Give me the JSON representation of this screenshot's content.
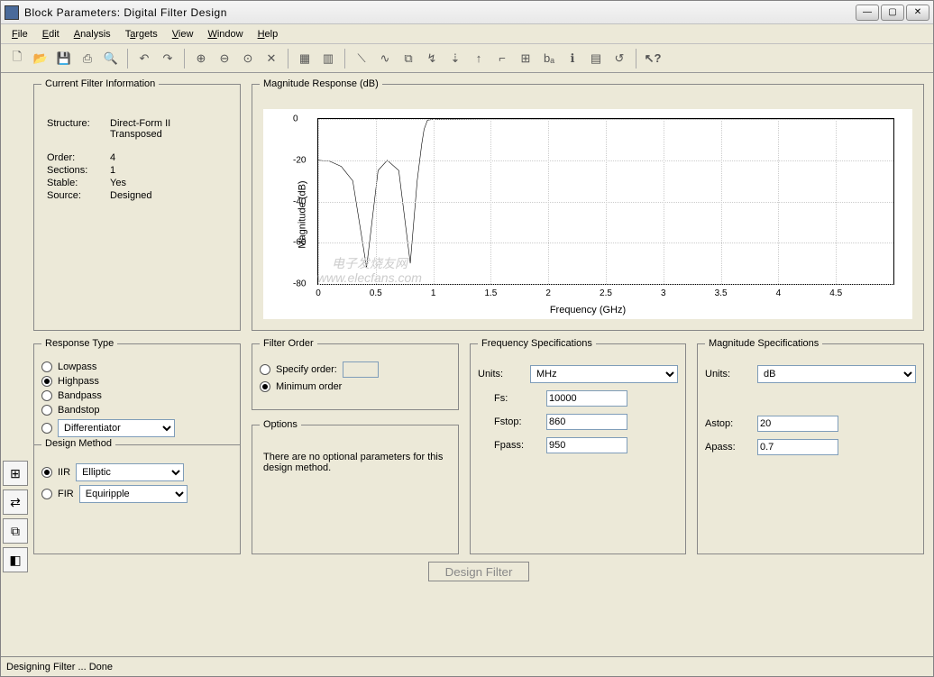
{
  "window": {
    "title": "Block Parameters: Digital Filter Design"
  },
  "menu": {
    "file": "File",
    "edit": "Edit",
    "analysis": "Analysis",
    "targets": "Targets",
    "view": "View",
    "window": "Window",
    "help": "Help"
  },
  "panels": {
    "current_info": {
      "legend": "Current Filter Information",
      "structure_label": "Structure:",
      "structure_value": "Direct-Form II Transposed",
      "order_label": "Order:",
      "order_value": "4",
      "sections_label": "Sections:",
      "sections_value": "1",
      "stable_label": "Stable:",
      "stable_value": "Yes",
      "source_label": "Source:",
      "source_value": "Designed"
    },
    "mag_response": {
      "legend": "Magnitude Response (dB)"
    },
    "response_type": {
      "legend": "Response Type",
      "lowpass": "Lowpass",
      "highpass": "Highpass",
      "bandpass": "Bandpass",
      "bandstop": "Bandstop",
      "diff": "Differentiator"
    },
    "design_method": {
      "legend": "Design Method",
      "iir": "IIR",
      "iir_sel": "Elliptic",
      "fir": "FIR",
      "fir_sel": "Equiripple"
    },
    "filter_order": {
      "legend": "Filter Order",
      "specify": "Specify order:",
      "minimum": "Minimum order"
    },
    "options": {
      "legend": "Options",
      "text": "There are no optional parameters for this design method."
    },
    "freq_spec": {
      "legend": "Frequency Specifications",
      "units_label": "Units:",
      "units_value": "MHz",
      "fs_label": "Fs:",
      "fs_value": "10000",
      "fstop_label": "Fstop:",
      "fstop_value": "860",
      "fpass_label": "Fpass:",
      "fpass_value": "950"
    },
    "mag_spec": {
      "legend": "Magnitude Specifications",
      "units_label": "Units:",
      "units_value": "dB",
      "astop_label": "Astop:",
      "astop_value": "20",
      "apass_label": "Apass:",
      "apass_value": "0.7"
    }
  },
  "buttons": {
    "design": "Design Filter"
  },
  "status": "Designing Filter ... Done",
  "watermark": {
    "line1": "电子发烧友网",
    "line2": "www.elecfans.com"
  },
  "chart_data": {
    "type": "line",
    "title": "Magnitude Response (dB)",
    "xlabel": "Frequency (GHz)",
    "ylabel": "Magnitude (dB)",
    "xlim": [
      0,
      5
    ],
    "ylim": [
      -80,
      0
    ],
    "xticks": [
      0,
      0.5,
      1,
      1.5,
      2,
      2.5,
      3,
      3.5,
      4,
      4.5
    ],
    "yticks": [
      0,
      -20,
      -40,
      -60,
      -80
    ],
    "series": [
      {
        "name": "Magnitude",
        "x": [
          0.0,
          0.1,
          0.2,
          0.3,
          0.42,
          0.52,
          0.6,
          0.7,
          0.8,
          0.86,
          0.9,
          0.92,
          0.95,
          1.0,
          1.5,
          5.0
        ],
        "y": [
          -20.0,
          -20.5,
          -23.0,
          -30.0,
          -72.0,
          -25.0,
          -20.0,
          -25.0,
          -70.0,
          -30.0,
          -12.0,
          -5.0,
          -0.5,
          -0.2,
          0.0,
          0.0
        ]
      }
    ]
  }
}
